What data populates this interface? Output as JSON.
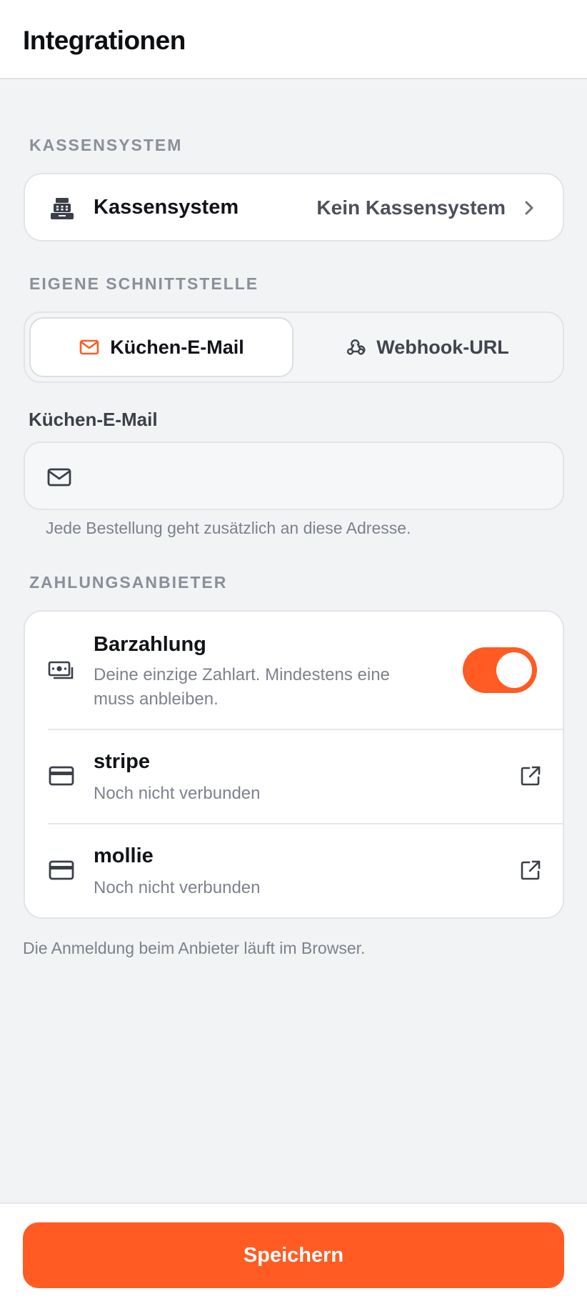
{
  "header": {
    "title": "Integrationen"
  },
  "pos_section": {
    "label": "KASSENSYSTEM",
    "row": {
      "title": "Kassensystem",
      "value": "Kein Kassensystem",
      "icon": "cash-register-icon"
    }
  },
  "interface_section": {
    "label": "EIGENE SCHNITTSTELLE",
    "tabs": [
      {
        "label": "Küchen-E-Mail",
        "icon": "mail-icon",
        "active": true
      },
      {
        "label": "Webhook-URL",
        "icon": "webhook-icon",
        "active": false
      }
    ],
    "email_field": {
      "label": "Küchen-E-Mail",
      "value": "",
      "placeholder": ""
    },
    "hint": "Jede Bestellung geht zusätzlich an diese Adresse."
  },
  "payment_section": {
    "label": "ZAHLUNGSANBIETER",
    "providers": [
      {
        "title": "Barzahlung",
        "subtitle_line1": "Deine einzige Zahlart. Mindestens eine",
        "subtitle_line2": "muss anbleiben.",
        "icon": "cash-icon",
        "enabled": true
      },
      {
        "title": "stripe",
        "subtitle": "Noch nicht verbunden",
        "icon": "credit-card-icon"
      },
      {
        "title": "mollie",
        "subtitle": "Noch nicht verbunden",
        "icon": "credit-card-icon"
      }
    ],
    "footnote": "Die Anmeldung beim Anbieter läuft im Browser."
  },
  "footer": {
    "save_label": "Speichern"
  },
  "colors": {
    "accent": "#ff5b22",
    "background": "#f2f3f5",
    "muted": "#8a8f99"
  }
}
